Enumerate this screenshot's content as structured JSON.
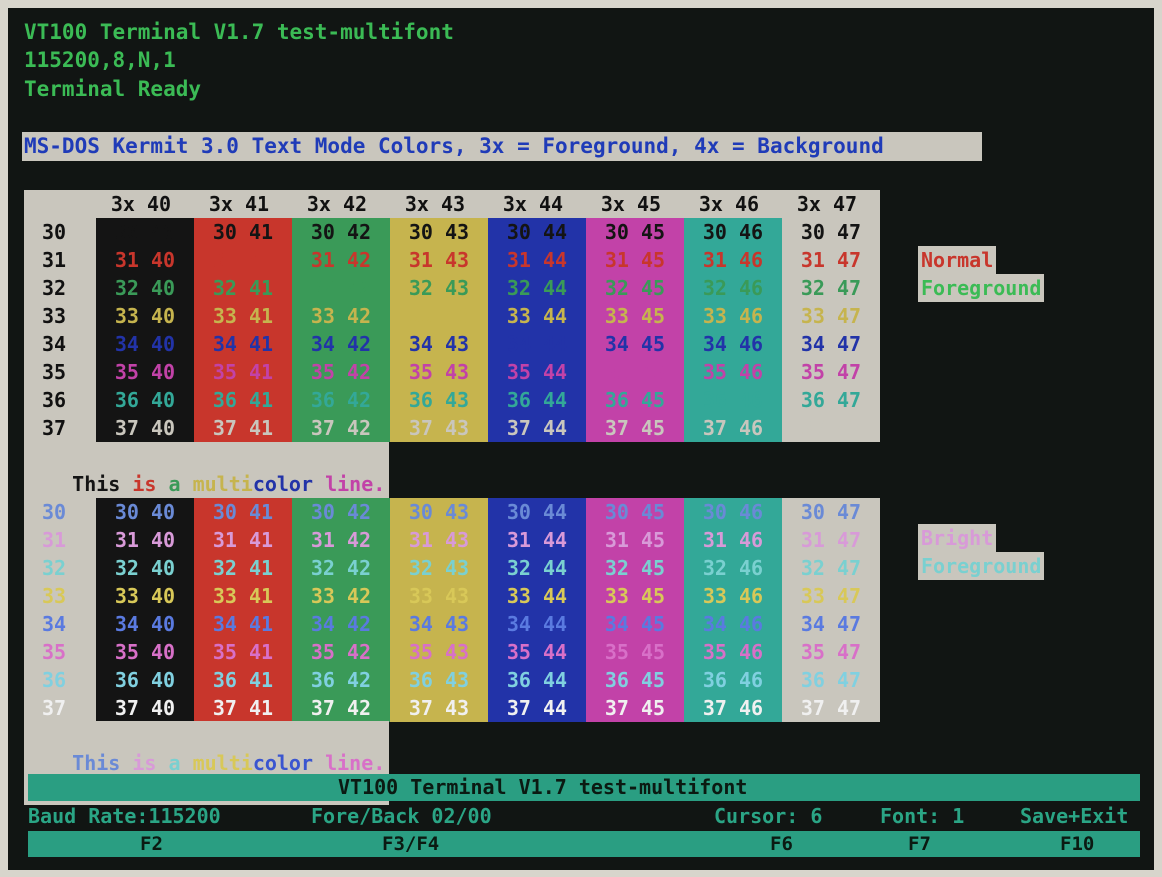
{
  "terminal": {
    "title_line": "VT100 Terminal V1.7 test-multifont",
    "serial_line": "115200,8,N,1",
    "status_line": "Terminal Ready",
    "banner": "MS-DOS Kermit 3.0 Text Mode Colors, 3x = Foreground, 4x = Background"
  },
  "normal_table": {
    "column_headers": [
      "3x 40",
      "3x 41",
      "3x 42",
      "3x 43",
      "3x 44",
      "3x 45",
      "3x 46",
      "3x 47"
    ],
    "row_labels": [
      "30",
      "31",
      "32",
      "33",
      "34",
      "35",
      "36",
      "37"
    ],
    "side_labels": [
      "Normal",
      "Foreground"
    ],
    "multicolor_words": [
      "This",
      " is",
      " a",
      " multi",
      "color",
      " line."
    ]
  },
  "bright_table": {
    "row_labels": [
      "30",
      "31",
      "32",
      "33",
      "34",
      "35",
      "36",
      "37"
    ],
    "side_labels": [
      "Bright",
      "Foreground"
    ],
    "multicolor_words": [
      "This",
      " is",
      " a",
      " multi",
      "color",
      " line."
    ]
  },
  "colors": {
    "bg_normal": [
      "#141414",
      "#c8362c",
      "#3a9a58",
      "#c6b44e",
      "#2233a8",
      "#c242a8",
      "#33a898",
      "#c9c6bd"
    ],
    "fg_normal": [
      "#141414",
      "#c8362c",
      "#3a9a58",
      "#c6b44e",
      "#2233a8",
      "#c242a8",
      "#33a898",
      "#c9c6bd"
    ],
    "fg_bright": [
      "#6a8ad6",
      "#d89ad8",
      "#7ad0d0",
      "#d8c858",
      "#5a7ae0",
      "#d870c8",
      "#80d0e0",
      "#f0f0f0"
    ],
    "screen_green": "#3bbb55",
    "accent_teal": "#2a9e82"
  },
  "statusbar": {
    "title": "VT100 Terminal V1.7 test-multifont",
    "baud": "Baud Rate:115200",
    "foreback": "Fore/Back 02/00",
    "cursor": "Cursor: 6",
    "font": "Font: 1",
    "save": "Save+Exit"
  },
  "keys": {
    "f2": "F2",
    "f3f4": "F3/F4",
    "f6": "F6",
    "f7": "F7",
    "f10": "F10"
  }
}
